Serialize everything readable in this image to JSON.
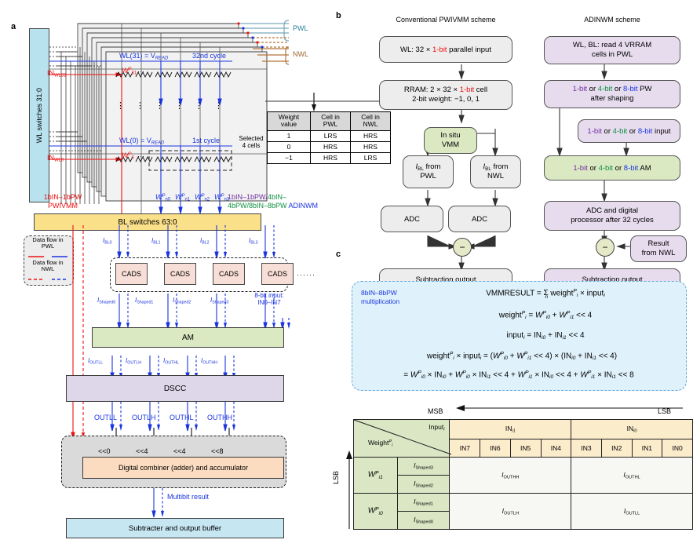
{
  "panels": {
    "a": "a",
    "b": "b",
    "c": "c"
  },
  "panel_a": {
    "wl_switches": "WL switches 31:0",
    "wl31_label": "WL(31) = V",
    "wl31_sub": "READ",
    "cycle32": "32nd cycle",
    "wl0_label": "WL(0) = V",
    "wl0_sub": "READ",
    "cycle1": "1st cycle",
    "selected_cells_line1": "Selected",
    "selected_cells_line2": "4 cells",
    "in_wl31": "IN",
    "in_wl31_sub": "WL31",
    "in_wl0": "IN",
    "in_wl0_sub": "WL0",
    "w31": "W",
    "w31_sup": "P",
    "w31_sub": "31",
    "w0": "W",
    "w0_sup": "P",
    "w0_sub": "0",
    "pwl_bracket": "PWL",
    "nwl_bracket": "NWL",
    "scheme_left_line1": "1bIN–1bPW",
    "scheme_left_line2": "PWIVMM",
    "scheme_right_1": "1bIN–1bPW/",
    "scheme_right_2": "4bIN–",
    "scheme_right_3": "4bPW/8bIN–8bPW",
    "scheme_right_4": " ADINWM",
    "wn_labels": [
      {
        "base": "W",
        "sup": "P",
        "sub": "n0"
      },
      {
        "base": "W",
        "sup": "P",
        "sub": "n1"
      },
      {
        "base": "W",
        "sup": "P",
        "sub": "n2"
      },
      {
        "base": "W",
        "sup": "P",
        "sub": "n3"
      }
    ],
    "bl_switches": "BL switches 63:0",
    "legend": {
      "pwl_line1": "Data flow in",
      "pwl_line2": "PWL",
      "nwl_line1": "Data flow in",
      "nwl_line2": "NWL"
    },
    "ibl_labels": [
      {
        "base": "I",
        "sub": "BL0"
      },
      {
        "base": "I",
        "sub": "BL1"
      },
      {
        "base": "I",
        "sub": "BL2"
      },
      {
        "base": "I",
        "sub": "BL3"
      }
    ],
    "cads": [
      "CADS",
      "CADS",
      "CADS",
      "CADS"
    ],
    "cads_ellipsis": "······",
    "ishaped_labels": [
      {
        "base": "I",
        "sub": "Shaped0"
      },
      {
        "base": "I",
        "sub": "Shaped1"
      },
      {
        "base": "I",
        "sub": "Shaped2"
      },
      {
        "base": "I",
        "sub": "Shaped3"
      }
    ],
    "eight_bit_input_line1": "8-bit input:",
    "eight_bit_input_line2": "IN0–IN7",
    "am": "AM",
    "iout_labels": [
      {
        "base": "I",
        "sub": "OUTLL"
      },
      {
        "base": "I",
        "sub": "OUTLH"
      },
      {
        "base": "I",
        "sub": "OUTHL"
      },
      {
        "base": "I",
        "sub": "OUTHH"
      }
    ],
    "dscc": "DSCC",
    "out_labels": [
      "OUTLL",
      "OUTLH",
      "OUTHL",
      "OUTHH"
    ],
    "shift_labels": [
      "<<0",
      "<<4",
      "<<4",
      "<<8"
    ],
    "digital_combiner": "Digital combiner (adder) and accumulator",
    "multibit_result": "Multibit result",
    "subtracter": "Subtracter and output buffer"
  },
  "weight_table": {
    "headers": [
      "Weight value",
      "Cell in PWL",
      "Cell in NWL"
    ],
    "headers_split": [
      [
        "Weight",
        "value"
      ],
      [
        "Cell in",
        "PWL"
      ],
      [
        "Cell in",
        "NWL"
      ]
    ],
    "rows": [
      [
        "1",
        "LRS",
        "HRS"
      ],
      [
        "0",
        "HRS",
        "HRS"
      ],
      [
        "−1",
        "HRS",
        "LRS"
      ]
    ]
  },
  "panel_b": {
    "left_title": "Conventional PWIVMM scheme",
    "right_title": "ADINWM scheme",
    "left": {
      "n1_a": "WL: 32 × ",
      "n1_b": "1-bit",
      "n1_c": " parallel input",
      "n2_l1_a": "RRAM: 2 × 32 × ",
      "n2_l1_b": "1-bit",
      "n2_l1_c": " cell",
      "n2_l2": "2-bit weight:  −1, 0, 1",
      "n3_l1": "In situ",
      "n3_l2": "VMM",
      "n4_base": "I",
      "n4_sub": "BL",
      "n4_rest": " from",
      "n4_l2": "PWL",
      "n5_base": "I",
      "n5_sub": "BL",
      "n5_rest": " from",
      "n5_l2": "NWL",
      "adc1": "ADC",
      "adc2": "ADC",
      "out": "Subtraction output"
    },
    "right": {
      "n1_l1": "WL, BL: read 4 VRRAM",
      "n1_l2": "cells in PWL",
      "n2_l1_1": "1-bit",
      "n2_l1_2": " or ",
      "n2_l1_3": "4-bit",
      "n2_l1_4": " or ",
      "n2_l1_5": "8-bit",
      "n2_l1_6": " PW",
      "n2_l2": "after shaping",
      "n3_1": "1-bit",
      "n3_2": " or ",
      "n3_3": "4-bit",
      "n3_4": " or ",
      "n3_5": "8-bit",
      "n3_6": " input",
      "n4_1": "1-bit",
      "n4_2": " or ",
      "n4_3": "4-bit",
      "n4_4": " or ",
      "n4_5": "8-bit",
      "n4_6": " AM",
      "n5_l1": "ADC and digital",
      "n5_l2": "processor after 32 cycles",
      "n6_l1": "Result",
      "n6_l2": "from NWL",
      "out": "Subtraction output"
    },
    "minus_glyph": "−"
  },
  "panel_c": {
    "mult_label_l1": "8bIN–8bPW",
    "mult_label_l2": "multiplication",
    "eq1": "VMMRESULT = Σ weight<sup>P</sup><sub>i</sub> × input<sub>i</sub>",
    "eq_sum_sub": "n",
    "equations": [
      "VMMRESULT = Σ<sub class='u'>n</sub> weight<sup>P</sup><sub>i</sub> × input<sub>i</sub>",
      "weight<sup>P</sup><sub>i</sub> = W<sup>P</sup><sub>i0</sub> + W<sup>P</sup><sub>i1</sub> << 4",
      "input<sub>i</sub> = IN<sub>i0</sub> + IN<sub>i1</sub> << 4",
      "weight<sup>P</sup><sub>i</sub> × input<sub>i</sub> = (W<sup>P</sup><sub>i0</sub> + W<sup>P</sup><sub>i1</sub> << 4) × (IN<sub>i0</sub> + IN<sub>i1</sub> << 4)",
      "= W<sup>P</sup><sub>i0</sub> × IN<sub>i0</sub> + W<sup>P</sup><sub>i0</sub> × IN<sub>i1</sub> << 4 + W<sup>P</sup><sub>i1</sub> × IN<sub>i0</sub> << 4 + W<sup>P</sup><sub>i1</sub> × IN<sub>i1</sub> << 8"
    ],
    "msb": "MSB",
    "lsb_top": "LSB",
    "lsb_side": "LSB",
    "table": {
      "corner_input": "Input",
      "corner_input_sub": "i",
      "corner_weight": "Weight",
      "corner_weight_sup": "P",
      "corner_weight_sub": "i",
      "group_hi": "IN",
      "group_hi_sub": "i1",
      "group_lo": "IN",
      "group_lo_sub": "i0",
      "bit_cols": [
        "IN7",
        "IN6",
        "IN5",
        "IN4",
        "IN3",
        "IN2",
        "IN1",
        "IN0"
      ],
      "rows": [
        {
          "w": "W",
          "w_sup": "P",
          "w_sub": "i1",
          "shaped": [
            {
              "base": "I",
              "sub": "Shaped3"
            },
            {
              "base": "I",
              "sub": "Shaped2"
            }
          ],
          "cell_hi": {
            "base": "I",
            "sub": "OUTHH"
          },
          "cell_lo": {
            "base": "I",
            "sub": "OUTHL"
          }
        },
        {
          "w": "W",
          "w_sup": "P",
          "w_sub": "i0",
          "shaped": [
            {
              "base": "I",
              "sub": "Shaped1"
            },
            {
              "base": "I",
              "sub": "Shaped0"
            }
          ],
          "cell_hi": {
            "base": "I",
            "sub": "OUTLH"
          },
          "cell_lo": {
            "base": "I",
            "sub": "OUTLL"
          }
        }
      ]
    }
  },
  "colors": {
    "wl_switch_fill": "#b9e2ef",
    "bl_switch_fill": "#fbe08a",
    "cads_fill": "#f7ded6",
    "am_fill": "#dbe9c3",
    "dscc_fill": "#ded7ea",
    "combiner_fill": "#fbdcc0",
    "subtracter_fill": "#c6e6f2",
    "grey_fill": "#ededed",
    "purple_fill": "#e6dcee",
    "green_fill": "#dbe9c3",
    "eqn_fill": "#dff1fa",
    "table_head_fill": "#fbeccb",
    "table_weight_fill": "#dbe6c5",
    "blue": "#1a35e0",
    "red": "#ee1111",
    "green": "#0e9040",
    "purple": "#7030a0"
  }
}
